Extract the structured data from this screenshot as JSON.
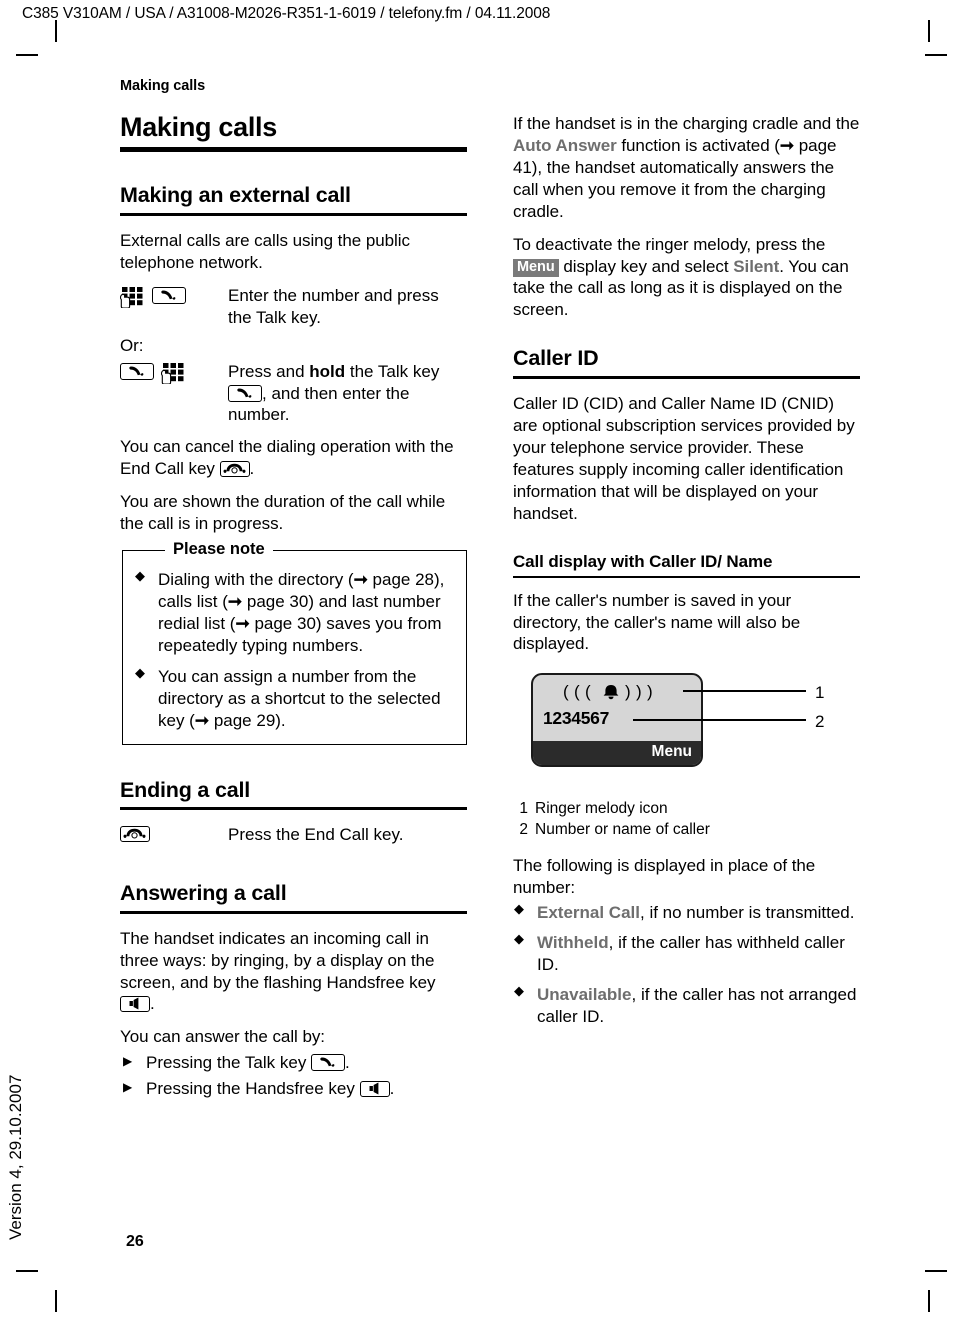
{
  "print_header": "C385 V310AM / USA / A31008-M2026-R351-1-6019 / telefony.fm / 04.11.2008",
  "side_version": "Version 4, 29.10.2007",
  "running_head": "Making calls",
  "page_number": "26",
  "left_column": {
    "chapter_title": "Making calls",
    "section_external": {
      "heading": "Making an external call",
      "intro": "External calls are calls using the public telephone network.",
      "steps": [
        {
          "icons": [
            "keypad-icon",
            "talk-key-icon"
          ],
          "desc": "Enter the number and press the Talk key."
        }
      ],
      "or_label": "Or:",
      "step2": {
        "icons": [
          "talk-key-icon",
          "keypad-icon"
        ],
        "desc_part1": "Press and ",
        "desc_bold": "hold",
        "desc_part2": " the Talk key ",
        "desc_part3": ", and then enter the number."
      },
      "cancel_text_a": "You can cancel the dialing operation with the End Call key ",
      "cancel_text_b": ".",
      "duration_text": "You are shown the duration of the call while the call is in progress."
    },
    "note_box": {
      "title": "Please note",
      "bullets": [
        {
          "segments": [
            "Dialing with the directory (",
            " page 28), calls list (",
            " page 30) and last number redial list (",
            " page 30) saves you from repeatedly typing numbers."
          ]
        },
        {
          "segments": [
            "You can assign a number from the directory as a shortcut to the selected key (",
            " page 29)."
          ]
        }
      ]
    },
    "section_ending": {
      "heading": "Ending a call",
      "step_desc": "Press the End Call key."
    },
    "section_answering": {
      "heading": "Answering a call",
      "para_a": "The handset indicates an incoming call in three ways: by ringing, by a display on the screen, and by the flashing Handsfree key ",
      "para_b": ".",
      "answer_intro": "You can answer the call by:",
      "answer_items": [
        {
          "text_a": "Pressing the Talk key ",
          "text_b": "."
        },
        {
          "text_a": "Pressing the Handsfree key ",
          "text_b": "."
        }
      ]
    }
  },
  "right_column": {
    "auto_answer_para": {
      "a": "If the handset is in the charging cradle and the ",
      "hl": "Auto Answer",
      "b": " function is activated (",
      "c": " page 41), the handset automatically answers the call when you remove it from the charging cradle."
    },
    "ringer_para": {
      "a": "To deactivate the ringer melody, press the ",
      "menu_key": "Menu",
      "b": " display key and select ",
      "hl": "Silent",
      "c": ". You can take the call as long as it is displayed on the screen."
    },
    "section_caller_id": {
      "heading": "Caller ID",
      "para": "Caller ID (CID) and Caller Name ID (CNID) are optional subscription services provided by your telephone service provider. These features supply incoming caller identification information that will be displayed on your handset."
    },
    "section_call_display": {
      "heading": "Call display with Caller ID/ Name",
      "para": "If the caller's number is saved in your directory, the caller's name will also be displayed."
    },
    "figure": {
      "ringer_icon": "(((♦)))",
      "number": "1234567",
      "softkey": "Menu",
      "callout_1": "1",
      "callout_2": "2"
    },
    "legend": [
      {
        "num": "1",
        "label": "Ringer melody icon"
      },
      {
        "num": "2",
        "label": "Number or name of caller"
      }
    ],
    "following_intro": "The following is displayed in place of the number:",
    "following_items": [
      {
        "hl": "External Call",
        "rest": ", if no number is transmitted."
      },
      {
        "hl": "Withheld",
        "rest": ", if the caller has withheld caller ID."
      },
      {
        "hl": "Unavailable",
        "rest": ", if the caller has not arranged caller ID."
      }
    ]
  },
  "colors": {
    "highlight": "#6e6e6e",
    "menu_badge_bg": "#7a7a7a",
    "display_bg": "#d6d6d6",
    "display_softbar": "#2b2b2b"
  }
}
